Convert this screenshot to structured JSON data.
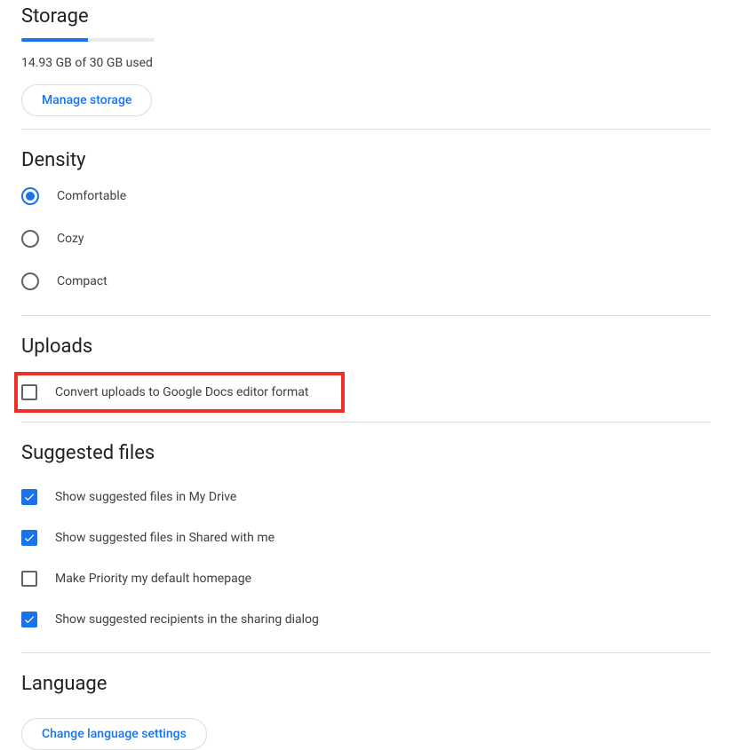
{
  "storage": {
    "heading": "Storage",
    "usage_text": "14.93 GB of 30 GB used",
    "manage_label": "Manage storage",
    "percent": 49.7
  },
  "density": {
    "heading": "Density",
    "options": [
      {
        "label": "Comfortable",
        "selected": true
      },
      {
        "label": "Cozy",
        "selected": false
      },
      {
        "label": "Compact",
        "selected": false
      }
    ]
  },
  "uploads": {
    "heading": "Uploads",
    "convert_label": "Convert uploads to Google Docs editor format",
    "convert_checked": false
  },
  "suggested": {
    "heading": "Suggested files",
    "items": [
      {
        "label": "Show suggested files in My Drive",
        "checked": true
      },
      {
        "label": "Show suggested files in Shared with me",
        "checked": true
      },
      {
        "label": "Make Priority my default homepage",
        "checked": false
      },
      {
        "label": "Show suggested recipients in the sharing dialog",
        "checked": true
      }
    ]
  },
  "language": {
    "heading": "Language",
    "change_label": "Change language settings"
  },
  "colors": {
    "accent": "#1a73e8",
    "highlight": "#ef2f26"
  }
}
